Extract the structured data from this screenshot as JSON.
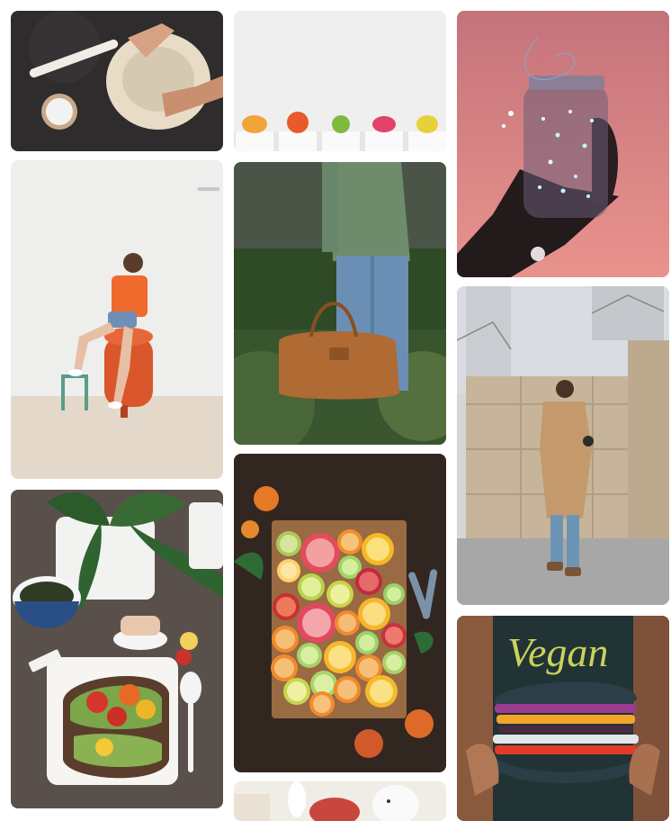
{
  "gallery": {
    "items": [
      {
        "subject": "Hands kneading dough with a rolling pin and bowl of flour"
      },
      {
        "subject": "Row of five small potted cacti on a white shelf"
      },
      {
        "subject": "Hand holding a mason jar filled with fairy lights"
      },
      {
        "subject": "Person in orange t-shirt sitting on a red tank"
      },
      {
        "subject": "Man in green shirt carrying a leather duffel bag"
      },
      {
        "subject": "Man in camel coat walking past a stone wall"
      },
      {
        "subject": "Avocado toast with tomatoes, plant and tea"
      },
      {
        "subject": "Sliced citrus fruits arranged on a wooden board"
      },
      {
        "subject": "Hands holding a colorful vegan sandwich"
      },
      {
        "subject": "Stuffed bunny toys on a light shelf"
      }
    ],
    "overlay_text": {
      "vegan_shirt": "Vegan"
    }
  }
}
